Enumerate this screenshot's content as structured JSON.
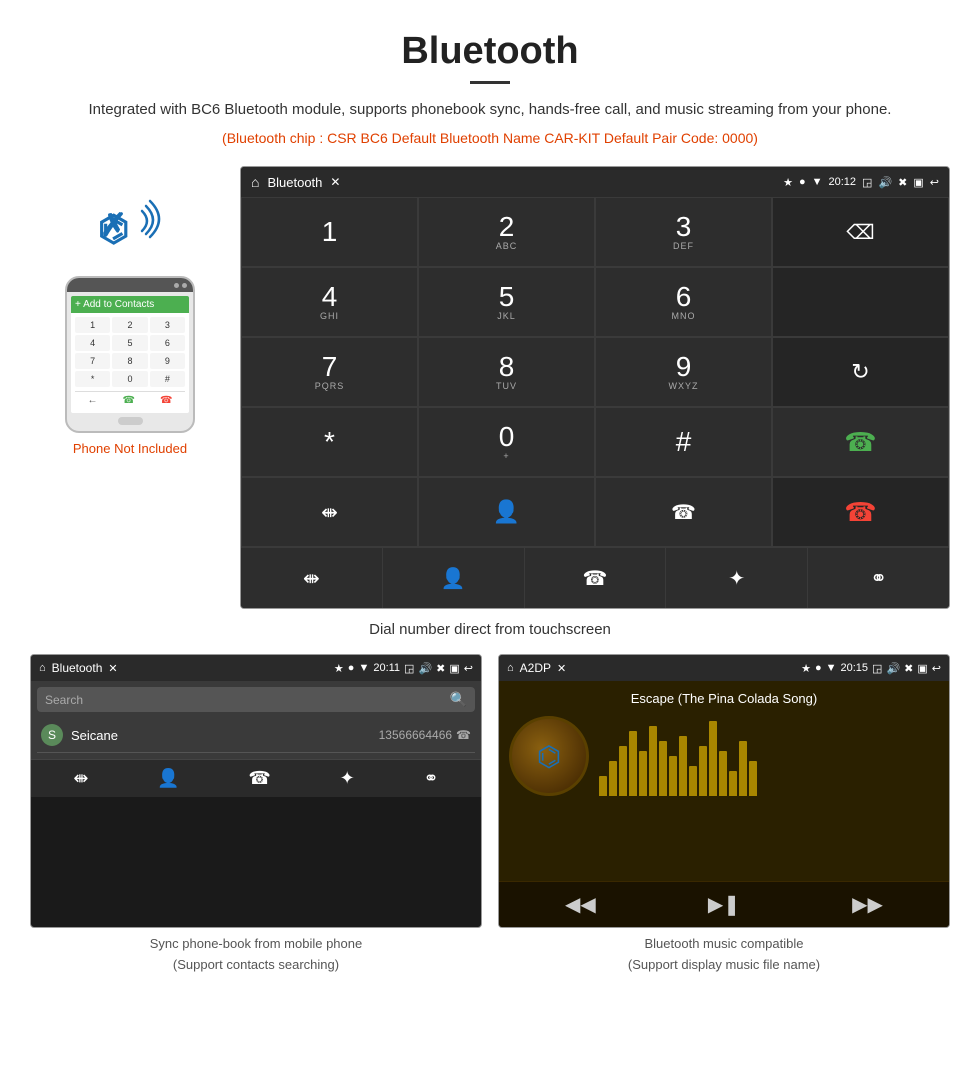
{
  "header": {
    "title": "Bluetooth",
    "description": "Integrated with BC6 Bluetooth module, supports phonebook sync, hands-free call, and music streaming from your phone.",
    "specs": "(Bluetooth chip : CSR BC6    Default Bluetooth Name CAR-KIT    Default Pair Code: 0000)"
  },
  "phone_not_included": "Phone Not Included",
  "dial_screen": {
    "title": "Bluetooth",
    "time": "20:12",
    "keys": [
      {
        "num": "1",
        "sub": ""
      },
      {
        "num": "2",
        "sub": "ABC"
      },
      {
        "num": "3",
        "sub": "DEF"
      },
      {
        "num": "4",
        "sub": "GHI"
      },
      {
        "num": "5",
        "sub": "JKL"
      },
      {
        "num": "6",
        "sub": "MNO"
      },
      {
        "num": "7",
        "sub": "PQRS"
      },
      {
        "num": "8",
        "sub": "TUV"
      },
      {
        "num": "9",
        "sub": "WXYZ"
      },
      {
        "num": "*",
        "sub": ""
      },
      {
        "num": "0",
        "sub": "+"
      },
      {
        "num": "#",
        "sub": ""
      }
    ]
  },
  "caption_center": "Dial number direct from touchscreen",
  "phonebook_screen": {
    "title": "Bluetooth",
    "time": "20:11",
    "search_placeholder": "Search",
    "contact_letter": "S",
    "contact_name": "Seicane",
    "contact_number": "13566664466"
  },
  "music_screen": {
    "title": "A2DP",
    "time": "20:15",
    "song": "Escape (The Pina Colada Song)"
  },
  "bottom_captions": {
    "left": "Sync phone-book from mobile phone\n(Support contacts searching)",
    "right": "Bluetooth music compatible\n(Support display music file name)"
  },
  "phone_keys": [
    "1",
    "2",
    "3",
    "4",
    "5",
    "6",
    "7",
    "8",
    "9",
    "*",
    "0",
    "#"
  ]
}
